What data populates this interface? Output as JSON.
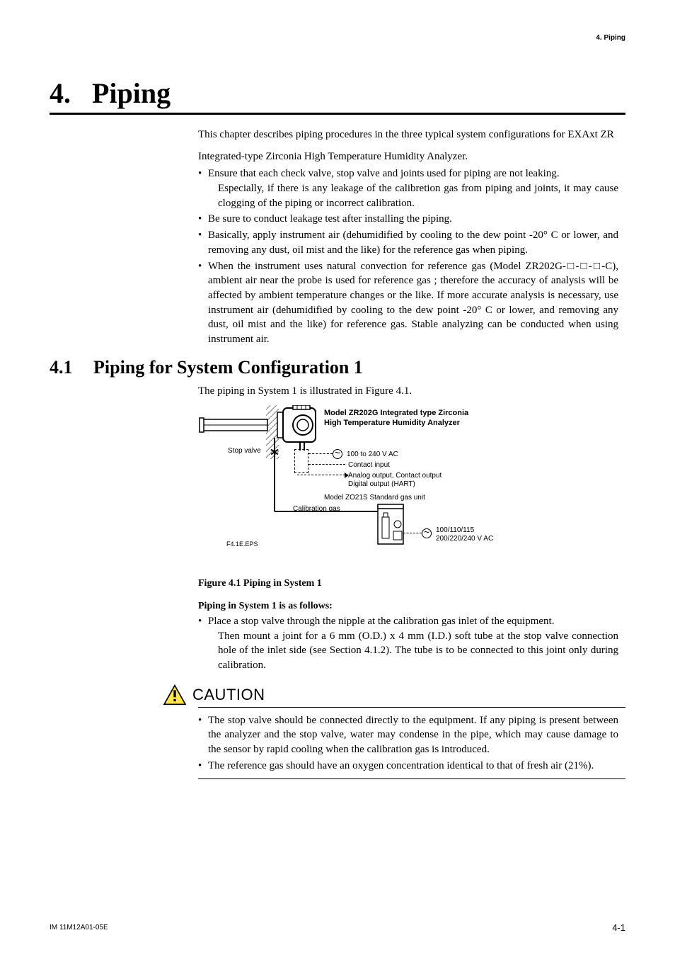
{
  "header": {
    "running": "4.  Piping"
  },
  "chapter": {
    "num": "4.",
    "title": "Piping"
  },
  "intro": {
    "p1": "This chapter describes piping procedures in the three typical system configurations for EXAxt ZR",
    "p2": "Integrated-type Zirconia High Temperature Humidity Analyzer.",
    "bullets": [
      {
        "lead": "Ensure that each check valve, stop valve and joints used for piping are not leaking.",
        "cont": "Especially, if there is any leakage of the calibretion gas from piping and joints, it may cause clogging of the piping or incorrect calibration."
      },
      {
        "lead": "Be sure to conduct leakage test after installing the piping."
      },
      {
        "lead": "Basically, apply instrument air (dehumidified by cooling to the dew point -20°  C or lower, and removing any dust, oil mist and the like) for the reference gas when piping."
      },
      {
        "lead": "When the instrument uses natural convection for reference gas (Model ZR202G-□-□-□-C), ambient air near the probe is used for reference gas ; therefore the accuracy of analysis will be affected by ambient temperature changes or the like. If more accurate analysis is necessary, use instrument air (dehumidified by cooling to the dew point -20°  C or lower, and removing any dust, oil mist and the like) for reference gas. Stable analyzing can be conducted when using instrument air."
      }
    ]
  },
  "section41": {
    "num": "4.1",
    "title": "Piping for System Configuration 1",
    "lead": "The piping in System 1 is illustrated in Figure 4.1."
  },
  "figure": {
    "model_line1": "Model ZR202G Integrated type Zirconia",
    "model_line2": "High Temperature Humidity Analyzer",
    "stop_valve": "Stop valve",
    "v_range": "100 to 240 V AC",
    "contact_in": "Contact input",
    "analog_out": "Analog output, Contact output",
    "digital_out": "Digital output (HART)",
    "gas_unit": "Model ZO21S Standard gas unit",
    "cal_gas": "Calibration gas",
    "v_alt1": "100/110/115",
    "v_alt2": "200/220/240 V AC",
    "eps": "F4.1E.EPS",
    "caption": "Figure 4.1   Piping in System 1"
  },
  "follows": {
    "heading": "Piping in System 1 is as follows:",
    "bullets": [
      {
        "lead": "Place a stop valve through the nipple at the calibration gas inlet of the equipment.",
        "cont": "Then mount a joint for a 6 mm (O.D.) x 4 mm (I.D.) soft tube at the stop valve connection hole of the inlet side (see Section 4.1.2). The tube is to be connected to this joint only during calibration."
      }
    ]
  },
  "caution": {
    "label": "CAUTION",
    "bullets": [
      "The stop valve should be connected directly to the equipment. If any piping is present between the analyzer and the stop valve,  water may condense in the pipe, which may cause damage to the sensor by rapid cooling when the calibration gas is introduced.",
      "The reference gas should have an oxygen concentration identical to that of fresh air (21%)."
    ]
  },
  "footer": {
    "left": "IM 11M12A01-05E",
    "right": "4-1"
  }
}
